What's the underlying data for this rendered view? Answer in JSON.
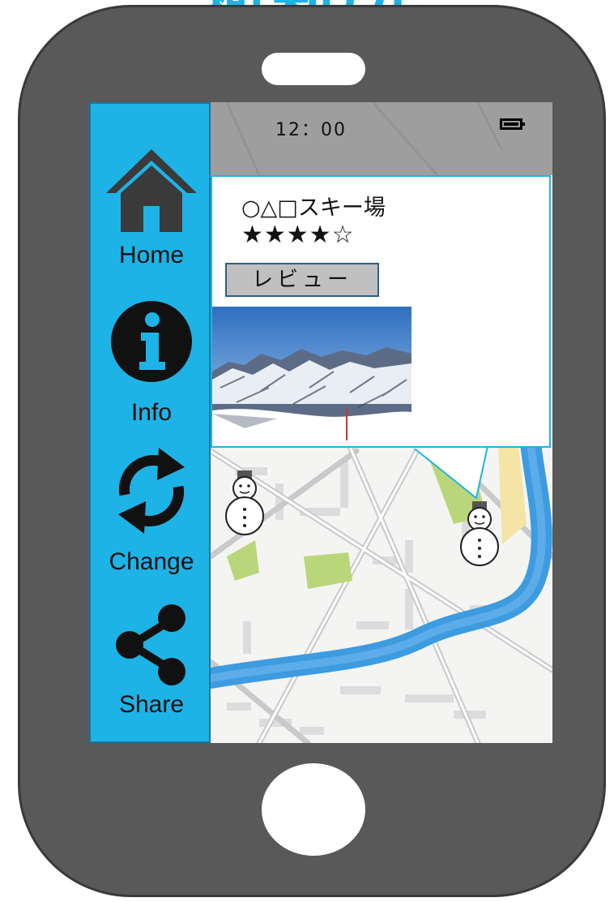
{
  "header": {
    "banner_text": "避難所"
  },
  "status_bar": {
    "time": "12：00",
    "battery_icon": "battery-full-icon"
  },
  "sidebar": {
    "items": [
      {
        "label": "Home",
        "icon": "home-icon"
      },
      {
        "label": "Info",
        "icon": "info-icon"
      },
      {
        "label": "Change",
        "icon": "refresh-icon"
      },
      {
        "label": "Share",
        "icon": "share-icon"
      }
    ]
  },
  "popup": {
    "title": "○△□スキー場",
    "rating_text": "★★★★☆",
    "rating_value": 4,
    "rating_max": 5,
    "review_button_label": "レビュー",
    "photo": "snowy-mountain-photo"
  },
  "map": {
    "markers": [
      {
        "icon": "snowman-icon"
      },
      {
        "icon": "snowman-icon"
      }
    ]
  },
  "colors": {
    "accent": "#1eb3e6",
    "phone_body": "#595959",
    "river": "#3d9be0",
    "park": "#b9d77a"
  }
}
